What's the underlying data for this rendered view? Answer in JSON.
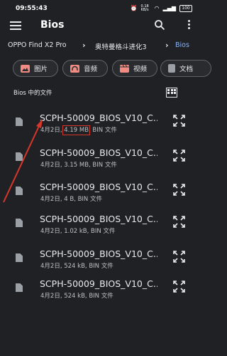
{
  "status_bar": {
    "time": "09:55:43",
    "net_speed": "0.18 KB/s",
    "battery": "100"
  },
  "app_bar": {
    "title": "Bios",
    "icons": [
      "menu-icon",
      "search-icon",
      "more-vert-icon"
    ]
  },
  "breadcrumb": [
    "OPPO Find X2 Pro",
    "奥特曼格斗进化3",
    "Bios"
  ],
  "chips": [
    {
      "label": "图片",
      "icon": "image-icon",
      "color": "#f28b82"
    },
    {
      "label": "音频",
      "icon": "headphones-icon",
      "color": "#f28b82"
    },
    {
      "label": "视频",
      "icon": "movie-icon",
      "color": "#f28b82"
    },
    {
      "label": "文档",
      "icon": "document-icon",
      "color": "#9aa0a6"
    }
  ],
  "section": {
    "title": "Bios 中的文件",
    "view_toggle_icon": "grid-view-icon"
  },
  "files": [
    {
      "name": "SCPH-50009_BIOS_V10_C...",
      "date": "4月2日, ",
      "size": "4.19 MB",
      "type": ", BIN 文件",
      "highlighted": true
    },
    {
      "name": "SCPH-50009_BIOS_V10_C...",
      "date": "4月2日, ",
      "size": "3.15 MB",
      "type": ", BIN 文件",
      "highlighted": false
    },
    {
      "name": "SCPH-50009_BIOS_V10_C...",
      "date": "4月2日, ",
      "size": "4 B",
      "type": ", BIN 文件",
      "highlighted": false
    },
    {
      "name": "SCPH-50009_BIOS_V10_C...",
      "date": "4月2日, ",
      "size": "1.02 kB",
      "type": ", BIN 文件",
      "highlighted": false
    },
    {
      "name": "SCPH-50009_BIOS_V10_C...",
      "date": "4月2日, ",
      "size": "524 kB",
      "type": ", BIN 文件",
      "highlighted": false
    },
    {
      "name": "SCPH-50009_BIOS_V10_C...",
      "date": "4月2日, ",
      "size": "524 kB",
      "type": ", BIN 文件",
      "highlighted": false
    }
  ],
  "colors": {
    "background": "#202124",
    "accent": "#8ab4f8",
    "annotation": "#d9362b"
  }
}
